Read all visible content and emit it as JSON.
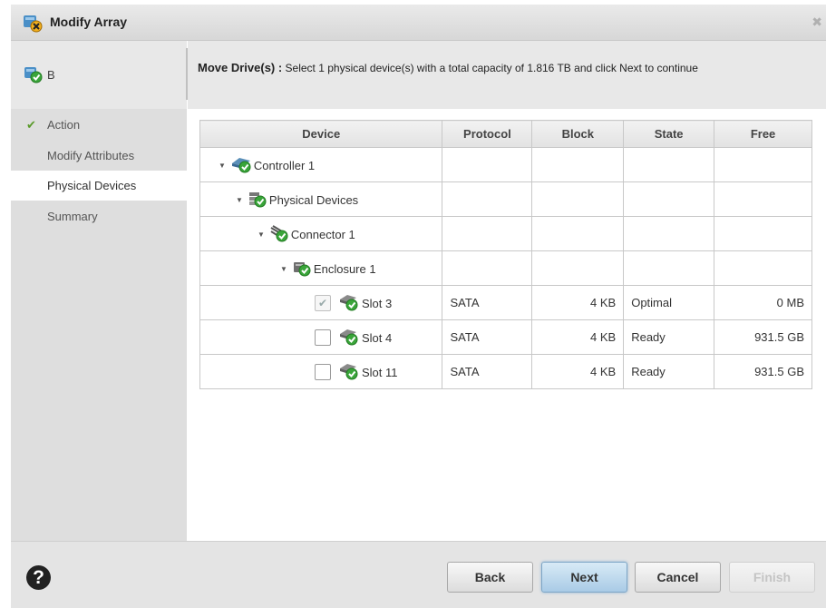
{
  "window": {
    "title": "Modify Array",
    "close_glyph": "✖",
    "icon": "array-modify-icon"
  },
  "header": {
    "array_name": "B",
    "instruction_bold": "Move Drive(s) :",
    "instruction_text": " Select 1 physical device(s) with a total capacity of 1.816 TB and click Next to continue"
  },
  "steps": [
    {
      "label": "Action",
      "done": true
    },
    {
      "label": "Modify Attributes",
      "done": false
    },
    {
      "label": "Physical Devices",
      "done": false,
      "active": true
    },
    {
      "label": "Summary",
      "done": false
    }
  ],
  "table": {
    "columns": [
      "Device",
      "Protocol",
      "Block",
      "State",
      "Free"
    ],
    "rows": [
      {
        "name": "Controller 1",
        "level": 0,
        "icon": "controller-icon",
        "expanded": true,
        "protocol": "",
        "block": "",
        "state": "",
        "free": ""
      },
      {
        "name": "Physical Devices",
        "level": 1,
        "icon": "physical-devices-icon",
        "expanded": true,
        "protocol": "",
        "block": "",
        "state": "",
        "free": ""
      },
      {
        "name": "Connector 1",
        "level": 2,
        "icon": "connector-icon",
        "expanded": true,
        "protocol": "",
        "block": "",
        "state": "",
        "free": ""
      },
      {
        "name": "Enclosure 1",
        "level": 3,
        "icon": "enclosure-icon",
        "expanded": true,
        "protocol": "",
        "block": "",
        "state": "",
        "free": ""
      },
      {
        "name": "Slot 3",
        "level": 4,
        "icon": "drive-icon",
        "checkbox": "checked-disabled",
        "protocol": "SATA",
        "block": "4 KB",
        "state": "Optimal",
        "free": "0 MB"
      },
      {
        "name": "Slot 4",
        "level": 4,
        "icon": "drive-icon",
        "checkbox": "unchecked",
        "protocol": "SATA",
        "block": "4 KB",
        "state": "Ready",
        "free": "931.5 GB"
      },
      {
        "name": "Slot 11",
        "level": 4,
        "icon": "drive-icon",
        "checkbox": "unchecked",
        "protocol": "SATA",
        "block": "4 KB",
        "state": "Ready",
        "free": "931.5 GB"
      }
    ]
  },
  "footer": {
    "help_glyph": "?",
    "back_label": "Back",
    "next_label": "Next",
    "cancel_label": "Cancel",
    "finish_label": "Finish"
  },
  "colors": {
    "ok_green": "#3aa53a",
    "accent_blue": "#a9cbe6",
    "check_green": "#5a9a2a"
  }
}
